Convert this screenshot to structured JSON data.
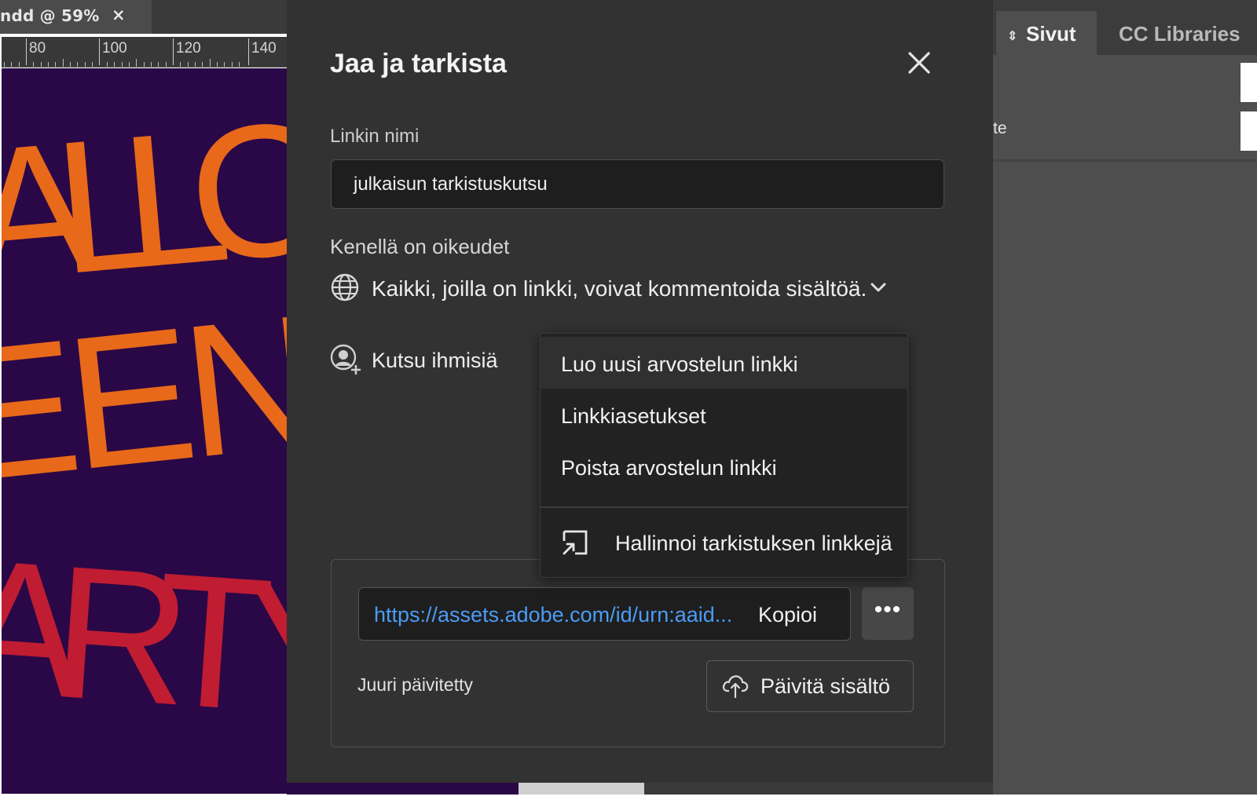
{
  "document_tab": {
    "title": "ndd @ 59%",
    "close_glyph": "×"
  },
  "ruler": {
    "labels": [
      "80",
      "100",
      "120",
      "140"
    ]
  },
  "canvas": {
    "background": "#2a0746",
    "lines": [
      {
        "text": "ALLO",
        "color": "#e8691a"
      },
      {
        "text": "EEN",
        "color": "#e8691a"
      },
      {
        "text": "ARTY",
        "color": "#c01c32"
      }
    ]
  },
  "right_panel": {
    "tabs": [
      {
        "label": "Sivut",
        "icon": "sort-arrows-icon",
        "active": true
      },
      {
        "label": "CC Libraries",
        "active": false
      }
    ],
    "partial_text": "te"
  },
  "dialog": {
    "title": "Jaa ja tarkista",
    "close_icon": "close-icon",
    "link_name_label": "Linkin nimi",
    "link_name_value": "julkaisun tarkistuskutsu",
    "permissions_label": "Kenellä on oikeudet",
    "permissions_value": "Kaikki, joilla on linkki, voivat kommentoida sisältöä.",
    "invite_label": "Kutsu ihmisiä",
    "link_url": "https://assets.adobe.com/id/urn:aaid...",
    "copy_label": "Kopioi",
    "more_label": "•••",
    "updated_status": "Juuri päivitetty",
    "update_button_label": "Päivitä sisältö",
    "colors": {
      "background": "#323232",
      "link": "#4b9cf5",
      "field": "#1e1e1e"
    }
  },
  "menu": {
    "items": [
      {
        "label": "Luo uusi arvostelun linkki",
        "highlighted": true
      },
      {
        "label": "Linkkiasetukset"
      },
      {
        "label": "Poista arvostelun linkki"
      }
    ],
    "footer_item": {
      "label": "Hallinnoi tarkistuksen linkkejä",
      "icon": "open-external-icon"
    }
  }
}
